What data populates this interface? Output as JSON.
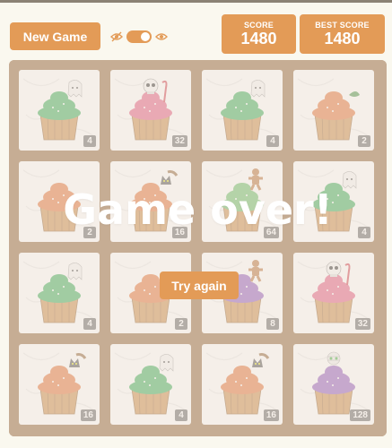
{
  "header": {
    "new_game_label": "New Game",
    "score_label": "SCORE",
    "score_value": "1480",
    "best_label": "BEST SCORE",
    "best_value": "1480"
  },
  "overlay": {
    "message": "Game over!",
    "retry_label": "Try again"
  },
  "colors": {
    "accent": "#e39b57",
    "board": "#8b5a2b",
    "badge": "#5a5a5a"
  },
  "tiles": [
    {
      "value": "4",
      "frosting": "#2fa84f",
      "topper": "ghost"
    },
    {
      "value": "32",
      "frosting": "#e0527a",
      "topper": "skull"
    },
    {
      "value": "4",
      "frosting": "#2fa84f",
      "topper": "ghost"
    },
    {
      "value": "2",
      "frosting": "#e06a2c",
      "topper": "leaf"
    },
    {
      "value": "2",
      "frosting": "#e06a2c",
      "topper": "none"
    },
    {
      "value": "16",
      "frosting": "#e06a2c",
      "topper": "cat"
    },
    {
      "value": "64",
      "frosting": "#5cb85c",
      "topper": "gingerbread"
    },
    {
      "value": "4",
      "frosting": "#2fa84f",
      "topper": "ghost"
    },
    {
      "value": "4",
      "frosting": "#2fa84f",
      "topper": "ghost"
    },
    {
      "value": "2",
      "frosting": "#e06a2c",
      "topper": "leaf"
    },
    {
      "value": "8",
      "frosting": "#8a4fb8",
      "topper": "gingerbread"
    },
    {
      "value": "32",
      "frosting": "#e0527a",
      "topper": "skull"
    },
    {
      "value": "16",
      "frosting": "#e06a2c",
      "topper": "cat"
    },
    {
      "value": "4",
      "frosting": "#2fa84f",
      "topper": "ghost"
    },
    {
      "value": "16",
      "frosting": "#e06a2c",
      "topper": "cat"
    },
    {
      "value": "128",
      "frosting": "#8a4fb8",
      "topper": "mummy"
    }
  ]
}
